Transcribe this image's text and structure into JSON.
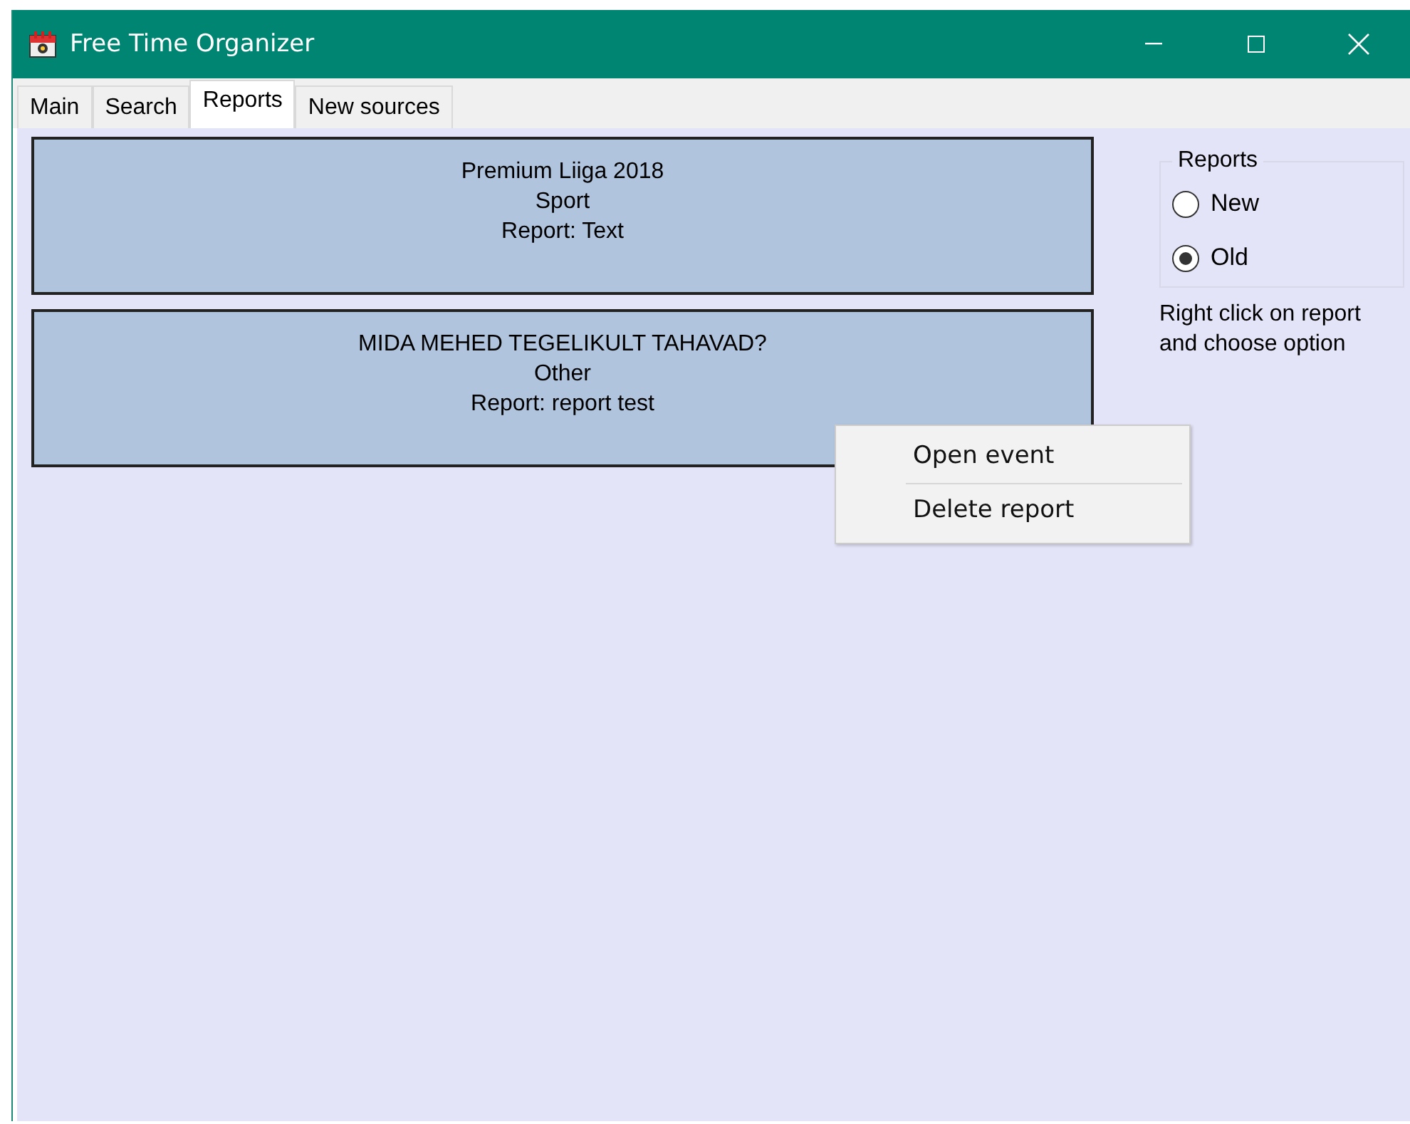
{
  "window": {
    "title": "Free Time Organizer"
  },
  "tabs": [
    {
      "label": "Main",
      "selected": false
    },
    {
      "label": "Search",
      "selected": false
    },
    {
      "label": "Reports",
      "selected": true
    },
    {
      "label": "New sources",
      "selected": false
    }
  ],
  "reports": [
    {
      "title": "Premium Liiga 2018",
      "category": "Sport",
      "report": "Report: Text"
    },
    {
      "title": "MIDA MEHED TEGELIKULT TAHAVAD?",
      "category": "Other",
      "report": "Report: report test"
    }
  ],
  "filter": {
    "legend": "Reports",
    "options": [
      {
        "label": "New",
        "selected": false
      },
      {
        "label": "Old",
        "selected": true
      }
    ]
  },
  "hint": "Right click on report and choose option",
  "context_menu": [
    "Open event",
    "Delete report"
  ]
}
